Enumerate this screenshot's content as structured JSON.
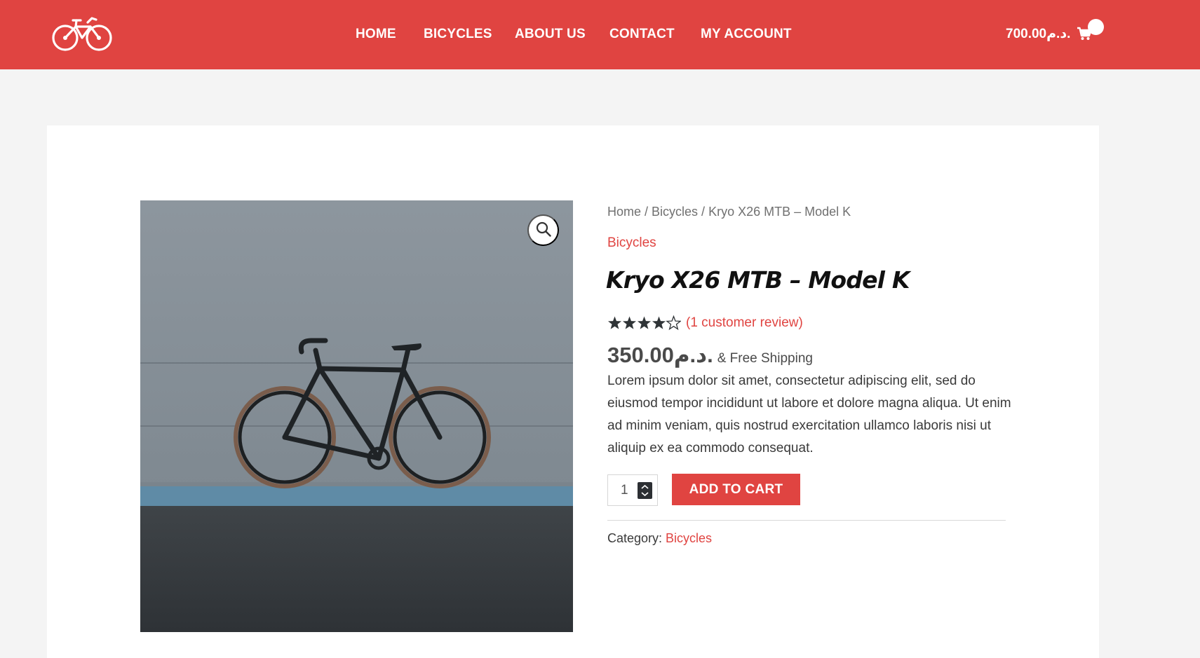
{
  "header": {
    "logo_icon": "bicycle-icon",
    "brand_color": "#e04441",
    "nav": [
      "HOME",
      "BICYCLES",
      "ABOUT US",
      "CONTACT",
      "MY ACCOUNT"
    ],
    "cart_total": "700.00د.م.",
    "cart_icon": "cart-icon"
  },
  "breadcrumb": {
    "items": [
      "Home",
      "Bicycles",
      "Kryo X26 MTB – Model K"
    ],
    "separator": " / "
  },
  "product": {
    "category": "Bicycles",
    "title": "Kryo X26 MTB – Model K",
    "rating": 4,
    "rating_max": 5,
    "review_text": "(1 customer review)",
    "price": "350.00د.م.",
    "shipping": "& Free Shipping",
    "description": "Lorem ipsum dolor sit amet, consectetur adipiscing elit, sed do eiusmod tempor incididunt ut labore et dolore magna aliqua. Ut enim ad minim veniam, quis nostrud exercitation ullamco laboris nisi ut aliquip ex ea commodo consequat.",
    "quantity": "1",
    "add_to_cart_label": "ADD TO CART",
    "meta_label": "Category:",
    "meta_category": "Bicycles",
    "zoom_icon": "magnifier-icon"
  }
}
